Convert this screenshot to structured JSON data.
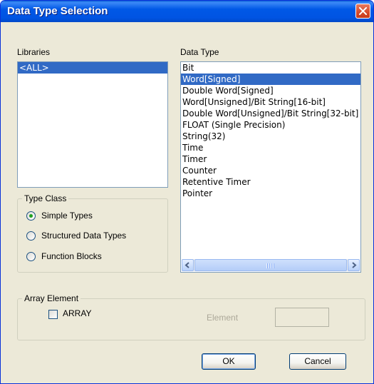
{
  "window": {
    "title": "Data Type Selection"
  },
  "libraries": {
    "label": "Libraries",
    "items": [
      "<ALL>"
    ],
    "selected_index": 0
  },
  "data_type": {
    "label": "Data Type",
    "items": [
      "Bit",
      "Word[Signed]",
      "Double Word[Signed]",
      "Word[Unsigned]/Bit String[16-bit]",
      "Double Word[Unsigned]/Bit String[32-bit]",
      "FLOAT (Single Precision)",
      "String(32)",
      "Time",
      "Timer",
      "Counter",
      "Retentive Timer",
      "Pointer"
    ],
    "selected_index": 1
  },
  "type_class": {
    "title": "Type Class",
    "options": [
      "Simple Types",
      "Structured Data Types",
      "Function Blocks"
    ],
    "selected_index": 0
  },
  "array_element": {
    "title": "Array Element",
    "checkbox_label": "ARRAY",
    "checked": false,
    "element_label": "Element",
    "element_value": ""
  },
  "buttons": {
    "ok": "OK",
    "cancel": "Cancel"
  },
  "icons": {
    "close": "close-icon",
    "scroll_left": "arrow-left-icon",
    "scroll_right": "arrow-right-icon"
  },
  "colors": {
    "selection": "#316ac5",
    "titlebar": "#0054e3",
    "dialog_bg": "#ece9d8",
    "radio_dot": "#21a121"
  }
}
